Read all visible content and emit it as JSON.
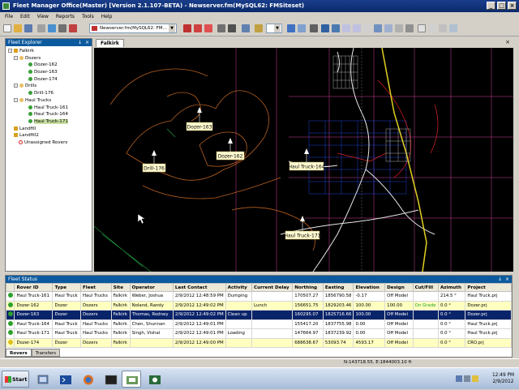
{
  "window": {
    "title": "Fleet Manager Office(Master) [Version 2.1.107-BETA) - Newserver.fm(MySQL62: FMSiteset)"
  },
  "menu": [
    "File",
    "Edit",
    "View",
    "Reports",
    "Tools",
    "Help"
  ],
  "toolbar": {
    "server_dropdown": "Newserver.fm(MySQL62: FM...",
    "colors": {
      "accent": "#0c5a9e",
      "title_bar": "#1a3e8c"
    }
  },
  "explorer": {
    "title": "Fleet Explorer",
    "pin": "↓",
    "close": "×",
    "tree": [
      {
        "label": "Falkirk",
        "level": 0,
        "icon": "site-icon"
      },
      {
        "label": "Dozers",
        "level": 1,
        "icon": "group-icon"
      },
      {
        "label": "Dozer-162",
        "level": 2,
        "icon": "rover-icon"
      },
      {
        "label": "Dozer-163",
        "level": 2,
        "icon": "rover-icon"
      },
      {
        "label": "Dozer-174",
        "level": 2,
        "icon": "rover-icon"
      },
      {
        "label": "Drills",
        "level": 1,
        "icon": "group-icon"
      },
      {
        "label": "Drill-176",
        "level": 2,
        "icon": "rover-icon"
      },
      {
        "label": "Haul Trucks",
        "level": 1,
        "icon": "group-icon"
      },
      {
        "label": "Haul Truck-161",
        "level": 2,
        "icon": "rover-icon"
      },
      {
        "label": "Haul Truck-164",
        "level": 2,
        "icon": "rover-icon"
      },
      {
        "label": "Haul Truck-171",
        "level": 2,
        "icon": "rover-icon",
        "selected": true
      },
      {
        "label": "Landfill",
        "level": 0,
        "icon": "site-icon"
      },
      {
        "label": "Landfill2",
        "level": 0,
        "icon": "site-icon"
      },
      {
        "label": "Unassigned Rovers",
        "level": 0,
        "icon": "no-icon"
      }
    ]
  },
  "map": {
    "tab": "Falkirk",
    "close": "×",
    "markers": [
      {
        "label": "Dozer-163"
      },
      {
        "label": "Dozer-162"
      },
      {
        "label": "Drill-176"
      },
      {
        "label": "Haul Truck-164"
      },
      {
        "label": "Haul Truck-171"
      }
    ]
  },
  "fleet_status": {
    "title": "Fleet Status",
    "pin": "↓",
    "close": "×",
    "columns": [
      "",
      "Rover ID",
      "Type",
      "Fleet",
      "Site",
      "Operator",
      "Last Contact",
      "Activity",
      "Current Delay",
      "Northing",
      "Easting",
      "Elevation",
      "Design",
      "Cut/Fill",
      "Azimuth",
      "Project"
    ],
    "rows": [
      {
        "cells": [
          "Haul Truck-161",
          "Haul Truck",
          "Haul Trucks",
          "Falkirk",
          "Weber, Joshua",
          "2/9/2012 12:48:59 PM",
          "Dumping",
          "",
          "170507.27",
          "1856790.58",
          "-0.17",
          "Off Model",
          "",
          "214.5 °",
          "Haul Truck.prj"
        ]
      },
      {
        "cells": [
          "Dozer-162",
          "Dozer",
          "Dozers",
          "Falkirk",
          "Noland, Randy",
          "2/9/2012 12:49:02 PM",
          "",
          "Lunch",
          "156651.75",
          "1829203.46",
          "100.00",
          "100.00",
          "On Grade",
          "0.0 °",
          "Dozer.prj"
        ],
        "highlight": "yellow"
      },
      {
        "cells": [
          "Dozer-163",
          "Dozer",
          "Dozers",
          "Falkirk",
          "Thomas, Rodney",
          "2/9/2012 12:49:02 PM",
          "Clean up",
          "",
          "160295.07",
          "1825716.66",
          "100.00",
          "Off Model",
          "",
          "0.0 °",
          "Dozer.prj"
        ],
        "highlight": "selected"
      },
      {
        "cells": [
          "Haul Truck-164",
          "Haul Truck",
          "Haul Trucks",
          "Falkirk",
          "Chen, Shunnan",
          "2/9/2012 12:49:01 PM",
          "",
          "",
          "155417.20",
          "1837755.98",
          "0.00",
          "Off Model",
          "",
          "0.0 °",
          "Haul Truck.prj"
        ]
      },
      {
        "cells": [
          "Haul Truck-171",
          "Haul Truck",
          "Haul Trucks",
          "Falkirk",
          "Singh, Vishal",
          "2/9/2012 12:49:01 PM",
          "Loading",
          "",
          "147664.97",
          "1837239.92",
          "0.00",
          "Off Model",
          "",
          "0.0 °",
          "Haul Truck.prj"
        ]
      },
      {
        "cells": [
          "Dozer-174",
          "Dozer",
          "Dozers",
          "Falkirk",
          "",
          "2/9/2012 12:49:00 PM",
          "",
          "",
          "688638.67",
          "53093.74",
          "4593.17",
          "Off Model",
          "",
          "0.0 °",
          "CRO.prj"
        ]
      }
    ],
    "tabs": [
      "Rovers",
      "Transfers"
    ]
  },
  "statusbar": {
    "coords": "N:143718.55, E:1844003.10 ft"
  },
  "taskbar": {
    "start_label": "Start",
    "clock_time": "12:49 PM",
    "clock_date": "2/9/2012"
  }
}
